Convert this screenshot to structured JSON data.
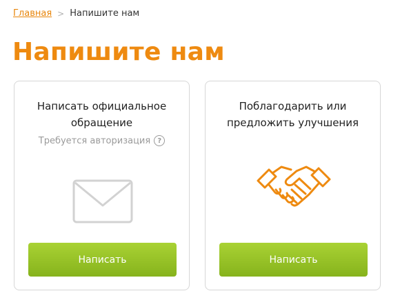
{
  "breadcrumb": {
    "home": "Главная",
    "separator": ">",
    "current": "Напишите нам"
  },
  "page": {
    "title": "Напишите нам"
  },
  "cards": [
    {
      "title": "Написать официальное обращение",
      "note": "Требуется авторизация",
      "icon": "envelope-icon",
      "button": "Написать"
    },
    {
      "title": "Поблагодарить или предложить улучшения",
      "icon": "handshake-icon",
      "button": "Написать"
    }
  ],
  "colors": {
    "accent": "#ee8a10",
    "link": "#e8860c",
    "button_top": "#a9d234",
    "button_bottom": "#86b31c",
    "icon_gray": "#d2d2d2"
  }
}
